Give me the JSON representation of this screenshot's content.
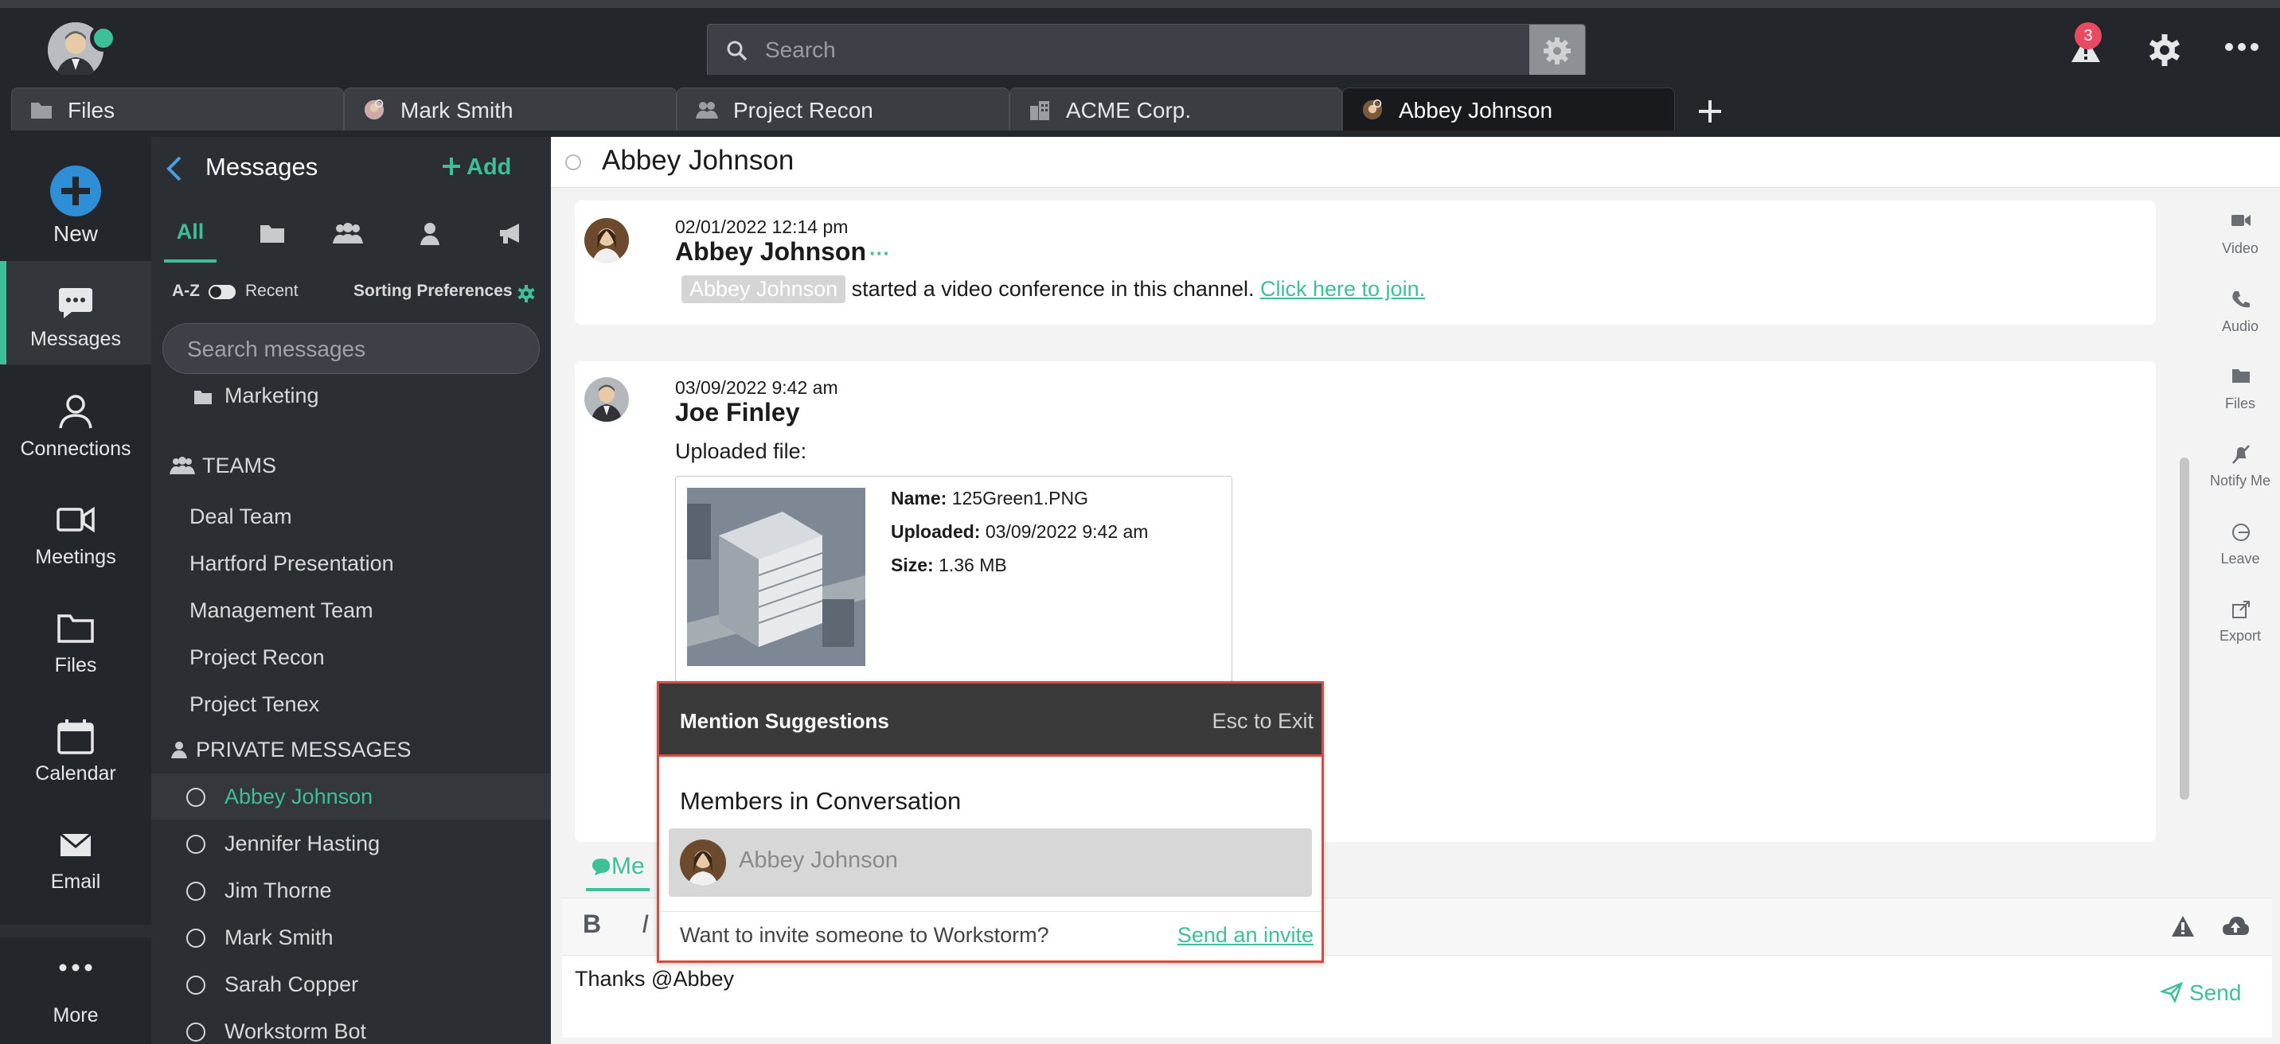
{
  "topbar": {
    "search_placeholder": "Search",
    "alert_count": "3"
  },
  "tabs": [
    {
      "label": "Files",
      "icon": "folder-icon"
    },
    {
      "label": "Mark Smith",
      "icon": "avatar-icon"
    },
    {
      "label": "Project Recon",
      "icon": "team-icon"
    },
    {
      "label": "ACME Corp.",
      "icon": "building-icon"
    },
    {
      "label": "Abbey Johnson",
      "icon": "avatar-icon",
      "active": true
    }
  ],
  "leftnav": {
    "new_label": "New",
    "items": [
      {
        "label": "Messages",
        "icon": "chat-icon",
        "active": true
      },
      {
        "label": "Connections",
        "icon": "person-icon"
      },
      {
        "label": "Meetings",
        "icon": "video-icon"
      },
      {
        "label": "Files",
        "icon": "folder-icon"
      },
      {
        "label": "Calendar",
        "icon": "calendar-icon"
      },
      {
        "label": "Email",
        "icon": "envelope-icon"
      },
      {
        "label": "More",
        "icon": "dots-icon"
      }
    ]
  },
  "panel": {
    "title": "Messages",
    "add_label": "Add",
    "filter_all": "All",
    "sort_az": "A-Z",
    "sort_recent": "Recent",
    "sorting_preferences": "Sorting Preferences",
    "search_placeholder": "Search messages",
    "folder_item": "Marketing",
    "teams_header": "TEAMS",
    "teams": [
      "Deal Team",
      "Hartford Presentation",
      "Management Team",
      "Project Recon",
      "Project Tenex"
    ],
    "private_header": "PRIVATE MESSAGES",
    "private": [
      "Abbey Johnson",
      "Jennifer Hasting",
      "Jim Thorne",
      "Mark Smith",
      "Sarah Copper",
      "Workstorm Bot"
    ]
  },
  "conversation": {
    "title": "Abbey Johnson",
    "messages": [
      {
        "time": "02/01/2022 12:14 pm",
        "author": "Abbey Johnson",
        "mention": "Abbey Johnson",
        "text": "started a video conference in this channel.",
        "link": "Click here to join."
      },
      {
        "time": "03/09/2022 9:42 am",
        "author": "Joe Finley",
        "text": "Uploaded file:",
        "file": {
          "name_label": "Name:",
          "name": "125Green1.PNG",
          "uploaded_label": "Uploaded:",
          "uploaded": "03/09/2022 9:42 am",
          "size_label": "Size:",
          "size": "1.36 MB"
        }
      }
    ]
  },
  "rightnav": [
    {
      "label": "Video",
      "icon": "video-icon"
    },
    {
      "label": "Audio",
      "icon": "phone-icon"
    },
    {
      "label": "Files",
      "icon": "folder-icon"
    },
    {
      "label": "Notify Me",
      "icon": "bell-off-icon"
    },
    {
      "label": "Leave",
      "icon": "leave-icon"
    },
    {
      "label": "Export",
      "icon": "export-icon"
    }
  ],
  "compose": {
    "tab_label": "Me",
    "bold": "B",
    "italic": "I",
    "input_value": "Thanks @Abbey",
    "send_label": "Send"
  },
  "mention_popup": {
    "title": "Mention Suggestions",
    "esc_label": "Esc to Exit",
    "section": "Members in Conversation",
    "suggestion": "Abbey Johnson",
    "invite_question": "Want to invite someone to Workstorm?",
    "invite_action": "Send an invite"
  },
  "colors": {
    "accent": "#3dbf9a",
    "highlight_border": "#d94a3f",
    "dark_bg": "#23262b"
  }
}
